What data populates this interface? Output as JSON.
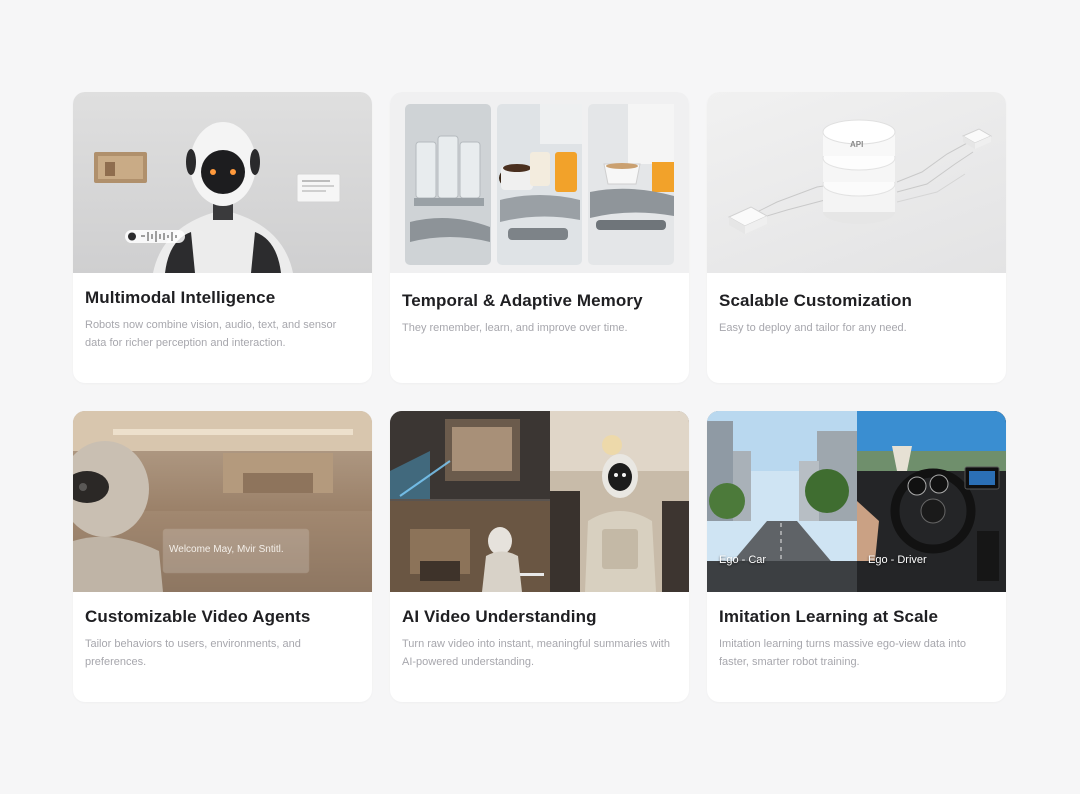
{
  "cards": [
    {
      "title": "Multimodal Intelligence",
      "description": "Robots now combine vision, audio, text, and sensor data for richer perception and interaction.",
      "image": "robot-multimodal-illustration"
    },
    {
      "title": "Temporal & Adaptive Memory",
      "description": "They remember, learn, and improve over time.",
      "image": "robot-hands-serving-drinks"
    },
    {
      "title": "Scalable Customization",
      "description": "Easy to deploy and tailor for any need.",
      "image": "api-database-illustration",
      "api_label": "API"
    },
    {
      "title": "Customizable Video Agents",
      "description": "Tailor behaviors to users, environments, and preferences.",
      "image": "robot-hotel-lobby",
      "overlay_text": "Welcome May, Mvir Sntitl."
    },
    {
      "title": "AI Video Understanding",
      "description": "Turn raw video into instant, meaningful summaries with AI-powered understanding.",
      "image": "robot-video-frames"
    },
    {
      "title": "Imitation Learning at Scale",
      "description": "Imitation learning turns massive ego-view data into faster, smarter robot training.",
      "image": "ego-view-driving",
      "captions": [
        "Ego - Car",
        "Ego - Driver"
      ]
    }
  ]
}
